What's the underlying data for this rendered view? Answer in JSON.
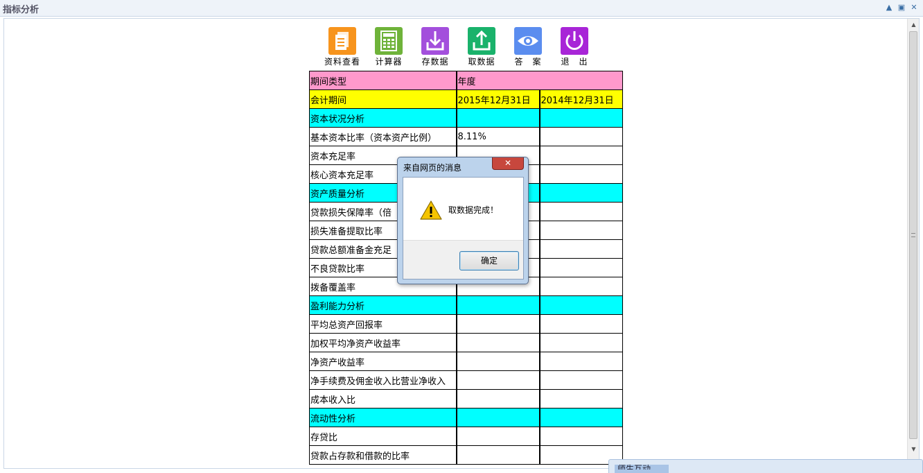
{
  "panel": {
    "title": "指标分析",
    "collapse_glyph": "▲",
    "maximize_glyph": "▣",
    "close_glyph": "✕"
  },
  "scrollbar": {
    "up_glyph": "▲",
    "down_glyph": "▼"
  },
  "toolbar": [
    {
      "label": "资料查看",
      "icon": "document-icon",
      "color": "#f7941d"
    },
    {
      "label": "计算器",
      "icon": "calculator-icon",
      "color": "#6fb33a"
    },
    {
      "label": "存数据",
      "icon": "save-download-icon",
      "color": "#a34fdc"
    },
    {
      "label": "取数据",
      "icon": "load-upload-icon",
      "color": "#1ab26b"
    },
    {
      "label": "答　案",
      "icon": "eye-icon",
      "color": "#5b8def"
    },
    {
      "label": "退　出",
      "icon": "power-icon",
      "color": "#a825d7"
    }
  ],
  "table": {
    "header1": {
      "label": "期间类型",
      "value": "年度"
    },
    "header2": {
      "label": "会计期间",
      "col1": "2015年12月31日",
      "col2": "2014年12月31日"
    },
    "rows": [
      {
        "label": "资本状况分析",
        "section": true,
        "v1": "",
        "v2": ""
      },
      {
        "label": "基本资本比率（资本资产比例）",
        "section": false,
        "v1": "8.11%",
        "v2": ""
      },
      {
        "label": "资本充足率",
        "section": false,
        "v1": "",
        "v2": ""
      },
      {
        "label": "核心资本充足率",
        "section": false,
        "v1": "",
        "v2": ""
      },
      {
        "label": "资产质量分析",
        "section": true,
        "v1": "",
        "v2": ""
      },
      {
        "label": "贷款损失保障率（倍",
        "section": false,
        "v1": "",
        "v2": ""
      },
      {
        "label": "损失准备提取比率",
        "section": false,
        "v1": "",
        "v2": ""
      },
      {
        "label": "贷款总额准备金充足",
        "section": false,
        "v1": "",
        "v2": ""
      },
      {
        "label": "不良贷款比率",
        "section": false,
        "v1": "",
        "v2": ""
      },
      {
        "label": "拨备覆盖率",
        "section": false,
        "v1": "",
        "v2": ""
      },
      {
        "label": "盈利能力分析",
        "section": true,
        "v1": "",
        "v2": ""
      },
      {
        "label": "平均总资产回报率",
        "section": false,
        "v1": "",
        "v2": ""
      },
      {
        "label": "加权平均净资产收益率",
        "section": false,
        "v1": "",
        "v2": ""
      },
      {
        "label": "净资产收益率",
        "section": false,
        "v1": "",
        "v2": ""
      },
      {
        "label": "净手续费及佣金收入比营业净收入",
        "section": false,
        "v1": "",
        "v2": ""
      },
      {
        "label": "成本收入比",
        "section": false,
        "v1": "",
        "v2": ""
      },
      {
        "label": "流动性分析",
        "section": true,
        "v1": "",
        "v2": ""
      },
      {
        "label": "存贷比",
        "section": false,
        "v1": "",
        "v2": ""
      },
      {
        "label": "贷款占存款和借款的比率",
        "section": false,
        "v1": "",
        "v2": ""
      }
    ]
  },
  "dialog": {
    "title": "来自网页的消息",
    "close_glyph": "✕",
    "message": "取数据完成！",
    "ok_label": "确定"
  },
  "chat": {
    "title": "师生互动"
  },
  "colors": {
    "pink": "#ff99cc",
    "yellow": "#ffff00",
    "cyan": "#00ffff"
  }
}
